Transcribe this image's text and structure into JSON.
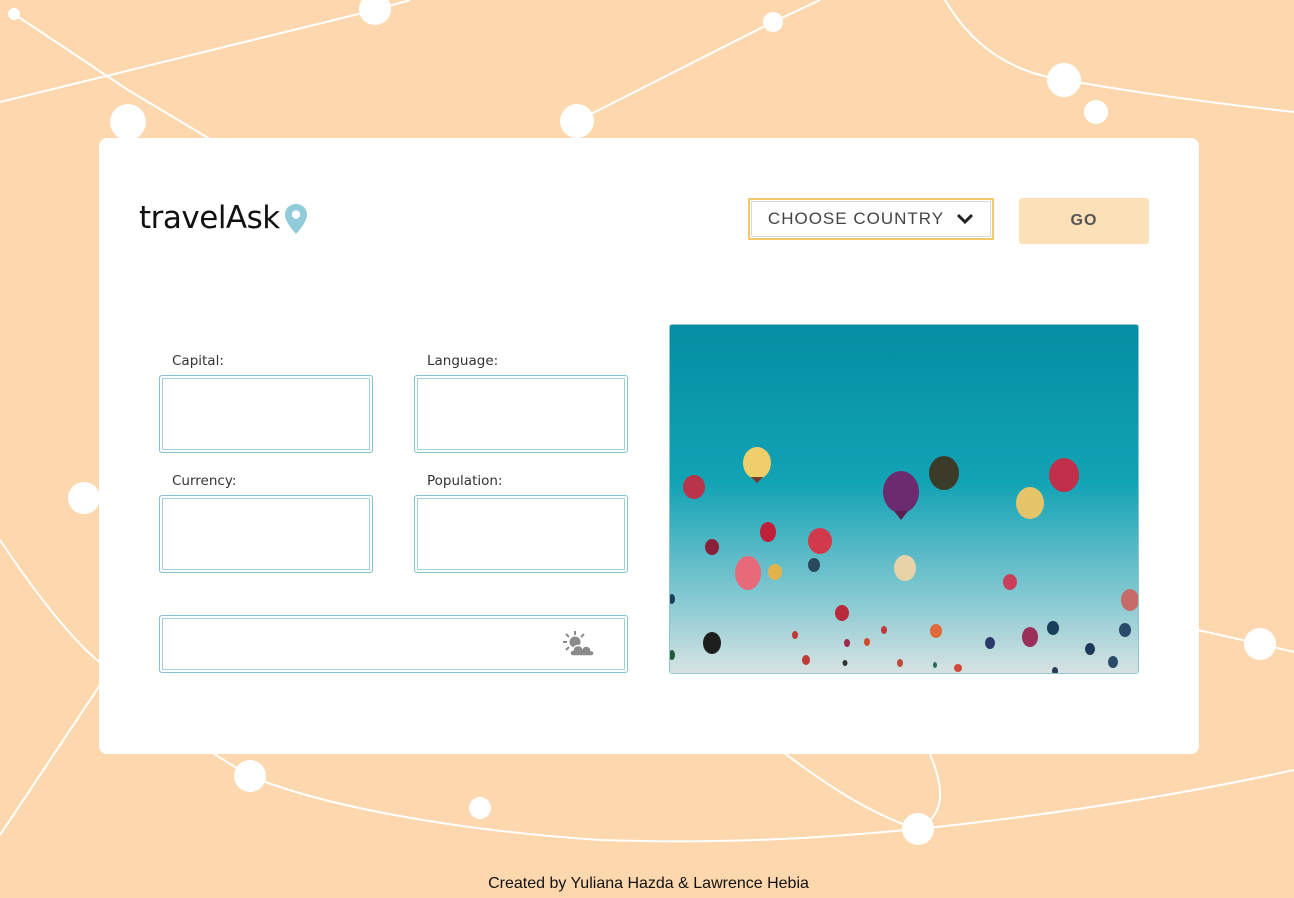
{
  "app": {
    "logo_text": "travelAsk",
    "icons": {
      "logo": "map-pin-icon",
      "dropdown": "chevron-down-icon",
      "weather": "partly-cloudy-icon"
    }
  },
  "controls": {
    "country_select": "CHOOSE COUNTRY",
    "go_button": "GO"
  },
  "fields": {
    "capital": {
      "label": "Capital:",
      "value": ""
    },
    "language": {
      "label": "Language:",
      "value": ""
    },
    "currency": {
      "label": "Currency:",
      "value": ""
    },
    "population": {
      "label": "Population:",
      "value": ""
    },
    "weather": {
      "value": ""
    }
  },
  "footer": {
    "credit": "Created by Yuliana Hazda & Lawrence Hebia"
  },
  "colors": {
    "background": "#fdd8ae",
    "card": "#ffffff",
    "accent_teal": "#86c2cc",
    "go_button": "#fbe0b8",
    "select_border": "#f2c96b",
    "pin": "#8fcbd9"
  }
}
